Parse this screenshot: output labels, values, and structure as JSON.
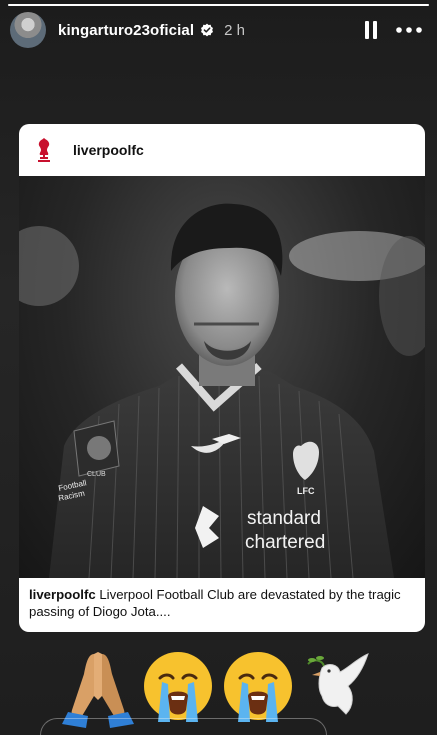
{
  "story": {
    "progress_fraction": 1.0,
    "header": {
      "username": "kingarturo23oficial",
      "time": "2 h",
      "avatar_icon": "profile-avatar",
      "verified_icon": "verified-badge-icon",
      "pause_icon": "pause-icon",
      "more_icon": "more-options-icon"
    },
    "shared_post": {
      "account": "liverpoolfc",
      "logo_icon": "liverpool-crest-icon",
      "photo": {
        "description_icon": "player-photo",
        "sponsor_text_1": "standard",
        "sponsor_text_2": "chartered",
        "sleeve_text_1": "Football",
        "sleeve_text_2": "Racism",
        "crest_text": "LFC",
        "badge_text": "CLUB"
      },
      "caption_user": "liverpoolfc",
      "caption_text": " Liverpool Football Club are devastated by the tragic passing of Diogo Jota...."
    },
    "reactions": [
      {
        "icon": "folded-hands-emoji"
      },
      {
        "icon": "loudly-crying-face-emoji"
      },
      {
        "icon": "loudly-crying-face-emoji"
      },
      {
        "icon": "dove-with-olive-branch-emoji"
      }
    ]
  }
}
